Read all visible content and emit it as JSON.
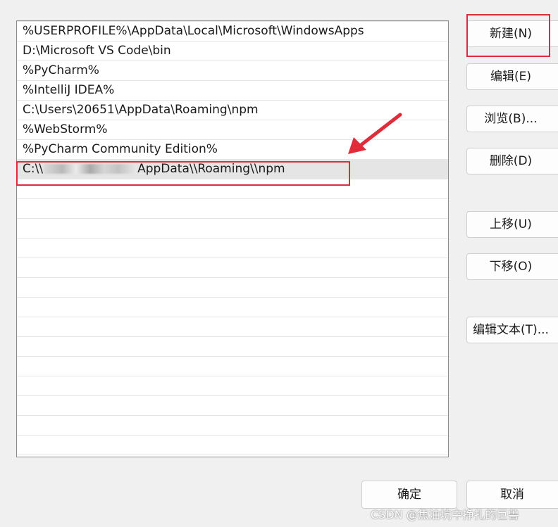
{
  "path_list": {
    "rows": [
      "%USERPROFILE%\\AppData\\Local\\Microsoft\\WindowsApps",
      "D:\\Microsoft VS Code\\bin",
      "%PyCharm%",
      "%IntelliJ IDEA%",
      "C:\\Users\\20651\\AppData\\Roaming\\npm",
      "%WebStorm%",
      "%PyCharm Community Edition%"
    ],
    "selected_row": {
      "prefix": "C:\\\\",
      "suffix": "AppData\\\\Roaming\\\\npm"
    }
  },
  "buttons": {
    "new": "新建(N)",
    "edit": "编辑(E)",
    "browse": "浏览(B)...",
    "delete": "删除(D)",
    "move_up": "上移(U)",
    "move_down": "下移(O)",
    "edit_text": "编辑文本(T)...",
    "ok": "确定",
    "cancel": "取消"
  },
  "annotation_color": "#e02b3a",
  "watermark": "CSDN @焦油坑中挣扎的巨兽"
}
